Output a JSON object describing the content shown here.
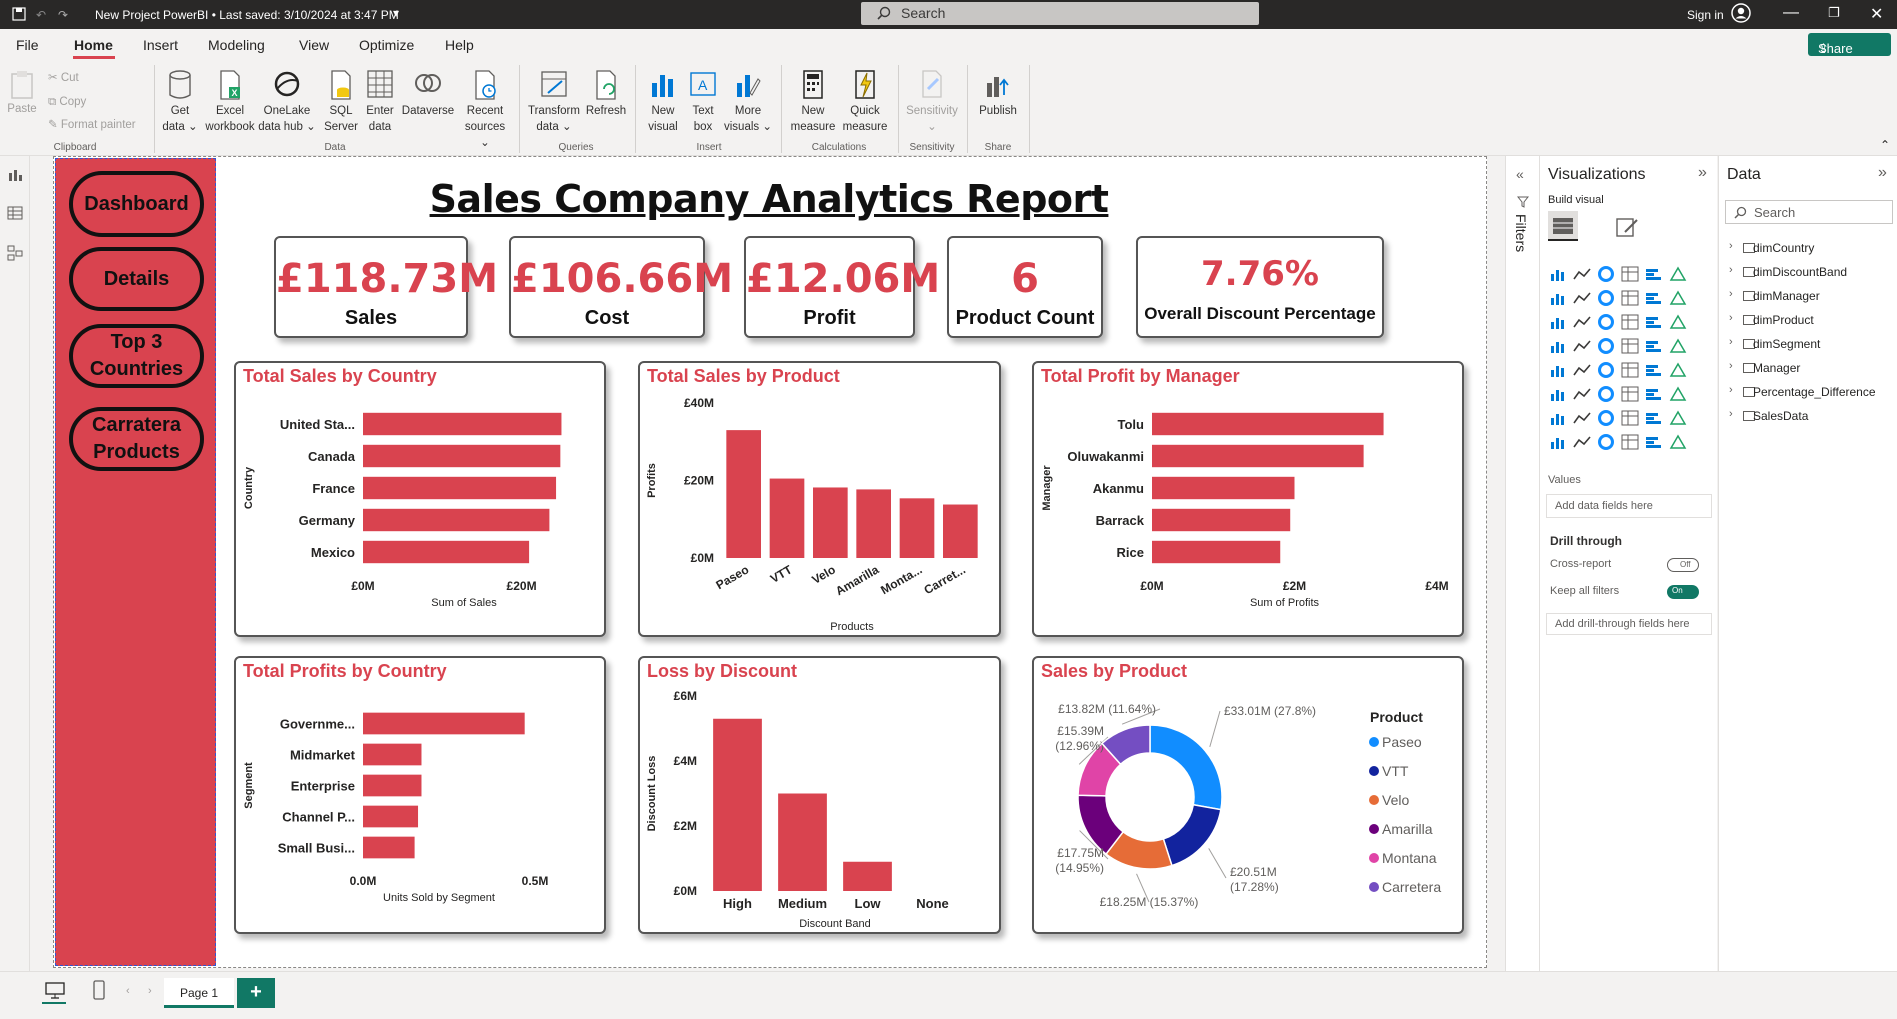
{
  "titlebar": {
    "title": "New Project PowerBI • Last saved: 3/10/2024 at 3:47 PM",
    "search_placeholder": "Search",
    "sign_in": "Sign in",
    "share": "Share"
  },
  "menu": [
    "File",
    "Home",
    "Insert",
    "Modeling",
    "View",
    "Optimize",
    "Help"
  ],
  "ribbon": {
    "clipboard": {
      "paste": "Paste",
      "cut": "Cut",
      "copy": "Copy",
      "format_painter": "Format painter",
      "group": "Clipboard"
    },
    "data": {
      "get_data": [
        "Get",
        "data"
      ],
      "excel": [
        "Excel",
        "workbook"
      ],
      "onelake": [
        "OneLake",
        "data hub"
      ],
      "sql": [
        "SQL",
        "Server"
      ],
      "enter": [
        "Enter",
        "data"
      ],
      "dataverse": "Dataverse",
      "recent": [
        "Recent",
        "sources"
      ],
      "group": "Data"
    },
    "queries": {
      "transform": [
        "Transform",
        "data"
      ],
      "refresh": "Refresh",
      "group": "Queries"
    },
    "insert": {
      "new_visual": [
        "New",
        "visual"
      ],
      "text_box": [
        "Text",
        "box"
      ],
      "more_visuals": [
        "More",
        "visuals"
      ],
      "group": "Insert"
    },
    "calculations": {
      "new_measure": [
        "New",
        "measure"
      ],
      "quick_measure": [
        "Quick",
        "measure"
      ],
      "group": "Calculations"
    },
    "sensitivity": {
      "label": "Sensitivity",
      "group": "Sensitivity"
    },
    "share": {
      "publish": "Publish",
      "group": "Share"
    }
  },
  "report": {
    "title": "Sales Company Analytics Report",
    "nav": [
      "Dashboard",
      "Details",
      "Top 3 Countries",
      "Carratera Products"
    ],
    "kpis": [
      {
        "value": "£118.73M",
        "label": "Sales"
      },
      {
        "value": "£106.66M",
        "label": "Cost"
      },
      {
        "value": "£12.06M",
        "label": "Profit"
      },
      {
        "value": "6",
        "label": "Product Count"
      },
      {
        "value": "7.76%",
        "label": "Overall Discount Percentage"
      }
    ],
    "accent": "#d9434f"
  },
  "chart_data": [
    {
      "id": "sales-country",
      "type": "bar",
      "orientation": "horizontal",
      "title": "Total Sales by Country",
      "categories": [
        "United Sta...",
        "Canada",
        "France",
        "Germany",
        "Mexico"
      ],
      "values": [
        25.03,
        24.89,
        24.35,
        23.51,
        20.95
      ],
      "xlabel": "Sum of Sales",
      "ylabel": "Country",
      "xticks": [
        "£0M",
        "£20M"
      ],
      "xlim": [
        0,
        28
      ]
    },
    {
      "id": "sales-product",
      "type": "bar",
      "title": "Total Sales by Product",
      "categories": [
        "Paseo",
        "VTT",
        "Velo",
        "Amarilla",
        "Monta...",
        "Carret..."
      ],
      "values": [
        33.0,
        20.5,
        18.2,
        17.7,
        15.4,
        13.8
      ],
      "xlabel": "Products",
      "ylabel": "Profits",
      "yticks": [
        "£0M",
        "£20M",
        "£40M"
      ],
      "ylim": [
        0,
        40
      ]
    },
    {
      "id": "profit-manager",
      "type": "bar",
      "orientation": "horizontal",
      "title": "Total Profit by Manager",
      "categories": [
        "Tolu",
        "Oluwakanmi",
        "Akanmu",
        "Barrack",
        "Rice"
      ],
      "values": [
        3.25,
        2.97,
        2.0,
        1.94,
        1.8
      ],
      "xlabel": "Sum of Profits",
      "ylabel": "Manager",
      "xticks": [
        "£0M",
        "£2M",
        "£4M"
      ],
      "xlim": [
        0,
        4
      ]
    },
    {
      "id": "profit-country",
      "type": "bar",
      "orientation": "horizontal",
      "title": "Total Profits by Country",
      "categories": [
        "Governme...",
        "Midmarket",
        "Enterprise",
        "Channel P...",
        "Small Busi..."
      ],
      "values": [
        0.47,
        0.17,
        0.17,
        0.16,
        0.15
      ],
      "xlabel": "Units Sold by Segment",
      "ylabel": "Segment",
      "xticks": [
        "0.0M",
        "0.5M"
      ],
      "xlim": [
        0,
        0.5
      ]
    },
    {
      "id": "loss-discount",
      "type": "bar",
      "title": "Loss by Discount",
      "categories": [
        "High",
        "Medium",
        "Low",
        "None"
      ],
      "values": [
        5.3,
        3.0,
        0.9,
        0
      ],
      "xlabel": "Discount Band",
      "ylabel": "Discount Loss",
      "yticks": [
        "£0M",
        "£2M",
        "£4M",
        "£6M"
      ],
      "ylim": [
        0,
        6
      ]
    },
    {
      "id": "sales-product-donut",
      "type": "pie",
      "title": "Sales by Product",
      "legend_title": "Product",
      "legend_position": "right",
      "series": [
        {
          "name": "Paseo",
          "value": 33.01,
          "label": "£33.01M (27.8%)",
          "color": "#118dff"
        },
        {
          "name": "VTT",
          "value": 20.51,
          "label": "£20.51M (17.28%)",
          "color": "#12239e"
        },
        {
          "name": "Velo",
          "value": 18.25,
          "label": "£18.25M (15.37%)",
          "color": "#e66c37"
        },
        {
          "name": "Amarilla",
          "value": 17.75,
          "label": "£17.75M (14.95%)",
          "color": "#6b007b"
        },
        {
          "name": "Montana",
          "value": 15.39,
          "label": "£15.39M (12.96%)",
          "color": "#e044a7"
        },
        {
          "name": "Carretera",
          "value": 13.82,
          "label": "£13.82M (11.64%)",
          "color": "#744ec2"
        }
      ]
    }
  ],
  "viz_pane": {
    "title": "Visualizations",
    "build": "Build visual",
    "values": "Values",
    "add_fields": "Add data fields here",
    "drill": "Drill through",
    "cross": "Cross-report",
    "cross_state": "Off",
    "keep": "Keep all filters",
    "keep_state": "On",
    "add_drill": "Add drill-through fields here",
    "filters_label": "Filters"
  },
  "data_pane": {
    "title": "Data",
    "search": "Search",
    "fields": [
      "dimCountry",
      "dimDiscountBand",
      "dimManager",
      "dimProduct",
      "dimSegment",
      "Manager",
      "Percentage_Difference",
      "SalesData"
    ]
  },
  "pages": {
    "tab": "Page 1",
    "add": "+"
  }
}
